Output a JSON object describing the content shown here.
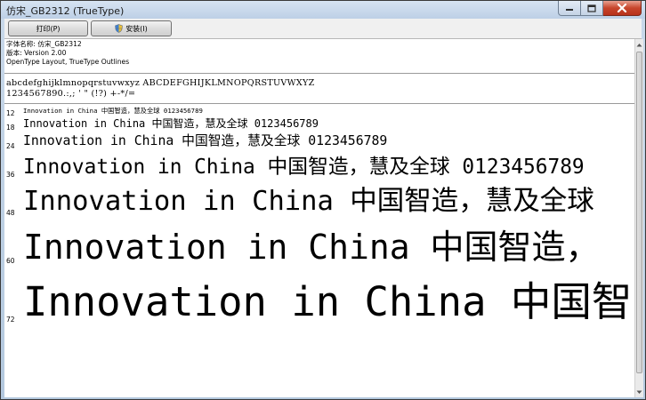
{
  "window": {
    "title": "仿宋_GB2312 (TrueType)"
  },
  "toolbar": {
    "print_label": "打印(P)",
    "install_label": "安装(I)"
  },
  "font_info": {
    "name_line": "字体名称: 仿宋_GB2312",
    "version_line": "版本: Version 2.00",
    "type_line": "OpenType Layout, TrueType Outlines"
  },
  "charset": {
    "line1": "abcdefghijklmnopqrstuvwxyz ABCDEFGHIJKLMNOPQRSTUVWXYZ",
    "line2": "1234567890.:,; ' \" (!?) +-*/="
  },
  "samples": [
    {
      "size": "12",
      "text": "Innovation in China 中国智造，慧及全球 0123456789"
    },
    {
      "size": "18",
      "text": "Innovation in China 中国智造，慧及全球 0123456789"
    },
    {
      "size": "24",
      "text": "Innovation in China 中国智造，慧及全球 0123456789"
    },
    {
      "size": "36",
      "text": "Innovation in China 中国智造，慧及全球 0123456789"
    },
    {
      "size": "48",
      "text": "Innovation in China 中国智造，慧及全球"
    },
    {
      "size": "60",
      "text": "Innovation in China 中国智造，"
    },
    {
      "size": "72",
      "text": "Innovation in China 中国智"
    }
  ],
  "icons": {
    "minimize": "minimize-icon",
    "maximize": "maximize-icon",
    "close": "close-icon",
    "install_shield": "shield-icon"
  }
}
